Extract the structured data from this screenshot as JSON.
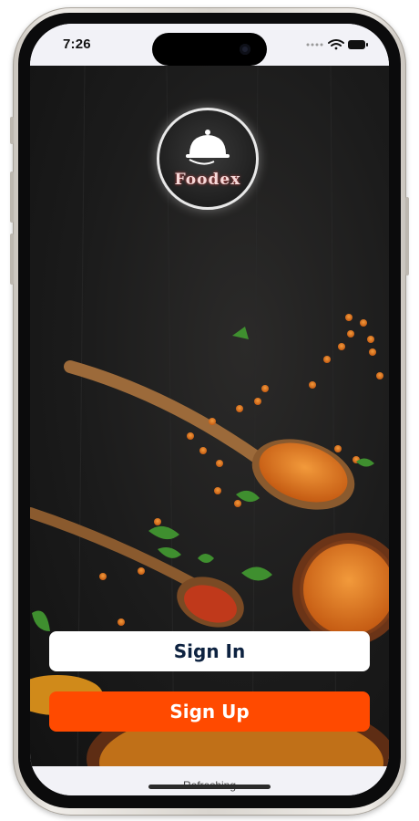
{
  "status_bar": {
    "time": "7:26"
  },
  "brand": {
    "name": "Foodex"
  },
  "actions": {
    "sign_in": "Sign In",
    "sign_up": "Sign Up"
  },
  "bottom_bar": {
    "label": "Refreshing"
  },
  "colors": {
    "primary": "#ff4a00",
    "navy": "#0d2240",
    "background": "#1b1b1b"
  }
}
